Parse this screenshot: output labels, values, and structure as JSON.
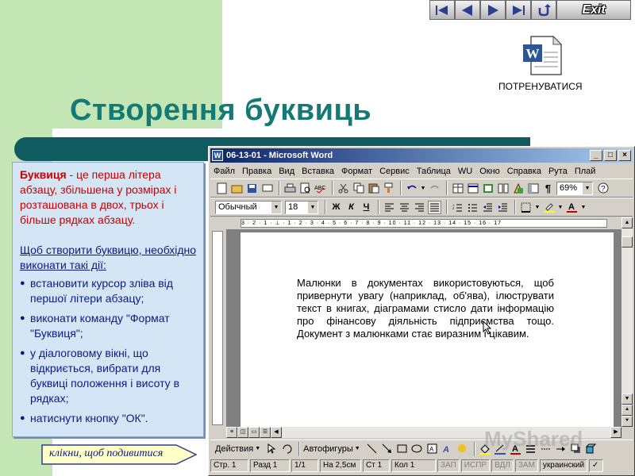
{
  "nav": {
    "buttons": [
      "first-icon",
      "prev-icon",
      "next-icon",
      "last-icon",
      "return-icon"
    ],
    "exit_label": "Exit"
  },
  "practice": {
    "icon": "word-document-icon",
    "label": "ПОТРЕНУВАТИСЯ"
  },
  "slide": {
    "title": "Створення буквиць"
  },
  "panel": {
    "term": "Буквиця",
    "definition": " - це перша літера абзацу, збільшена у розмірах і розташована в двох, трьох і більше рядках абзацу.",
    "intro": "Щоб створити буквицю, необхідно виконати такі дії:",
    "steps": [
      "встановити курсор зліва від першої літери абзацу;",
      "виконати команду \"Формат \"Буквиця\";",
      "у діалоговому вікні, що відкриється, вибрати для буквиці положення і висоту в рядках;",
      "натиснути кнопку \"ОК\"."
    ]
  },
  "callout": {
    "text": "клікни, щоб подивитися"
  },
  "word": {
    "title": "06-13-01 - Microsoft Word",
    "window_controls": [
      "_",
      "□",
      "×"
    ],
    "menu": [
      "Файл",
      "Правка",
      "Вид",
      "Вставка",
      "Формат",
      "Сервис",
      "Таблица",
      "WU",
      "Окно",
      "Справка",
      "Рута",
      "Плай"
    ],
    "zoom": "69%",
    "style": "Обычный",
    "font_size": "18",
    "format_buttons": [
      "Ж",
      "К",
      "Ч"
    ],
    "paragraph_mark": "¶",
    "ruler_text": "3 · 2 · 1 · ⊥ · 1 · 2 · 3 · 4 · 5 · 6 · 7 · 8 · 9 · 10 · 11 · 12 · 13 · 14 · 15 · 16 · 17",
    "document_text": "Малюнки в документах використовуються, щоб привернути увагу (наприклад, об'ява), ілюструвати текст в книгах, діаграмами стисло дати інформацію про фінансову діяльність підприємства тощо. Документ з малюнками стає виразним і цікавим.",
    "drawing": {
      "actions_label": "Действия",
      "autoshapes_label": "Автофигуры"
    },
    "status": {
      "page": "Стр. 1",
      "section": "Разд 1",
      "pages": "1/1",
      "position": "На 2,5см",
      "line": "Ст 1",
      "column": "Кол 1",
      "modes": [
        "ЗАП",
        "ИСПР",
        "ВДЛ",
        "ЗАМ"
      ],
      "language": "украинский"
    }
  },
  "watermark": "MyShared"
}
